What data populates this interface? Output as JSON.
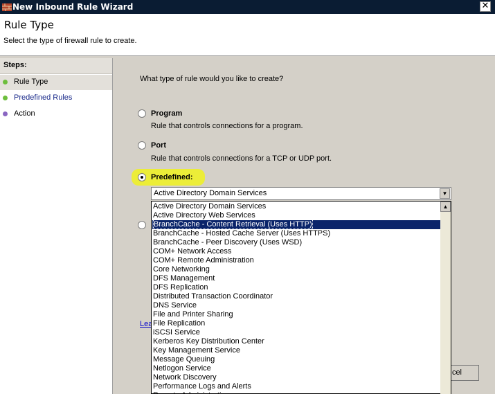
{
  "window": {
    "title": "New Inbound Rule Wizard",
    "close_glyph": "✕",
    "title_color": "#0a1c33"
  },
  "header": {
    "title": "Rule Type",
    "subtitle": "Select the type of firewall rule to create."
  },
  "steps": {
    "heading": "Steps:",
    "items": [
      {
        "label": "Rule Type",
        "selected": true,
        "dot_color": "#6dbe3c"
      },
      {
        "label": "Predefined Rules",
        "selected": false,
        "dot_color": "#6dbe3c"
      },
      {
        "label": "Action",
        "selected": false,
        "dot_color": "#8a66c2"
      }
    ]
  },
  "main": {
    "question": "What type of rule would you like to create?",
    "options": [
      {
        "label": "Program",
        "description": "Rule that controls connections for a program.",
        "checked": false
      },
      {
        "label": "Port",
        "description": "Rule that controls connections for a TCP or UDP port.",
        "checked": false
      },
      {
        "label": "Predefined:",
        "description": "",
        "checked": true
      }
    ],
    "predefined_selected": "Active Directory Domain Services",
    "predefined_list": [
      "Active Directory Domain Services",
      "Active Directory Web Services",
      "BranchCache - Content Retrieval (Uses HTTP)",
      "BranchCache - Hosted Cache Server (Uses HTTPS)",
      "BranchCache - Peer Discovery (Uses WSD)",
      "COM+ Network Access",
      "COM+ Remote Administration",
      "Core Networking",
      "DFS Management",
      "DFS Replication",
      "Distributed Transaction Coordinator",
      "DNS Service",
      "File and Printer Sharing",
      "File Replication",
      "iSCSI Service",
      "Kerberos Key Distribution Center",
      "Key Management Service",
      "Message Queuing",
      "Netlogon Service",
      "Network Discovery",
      "Performance Logs and Alerts",
      "Remote Administration"
    ],
    "highlighted_index": 2,
    "learn_link": "Lea",
    "cancel_label": "cel",
    "highlight_color": "#f0f21f"
  }
}
